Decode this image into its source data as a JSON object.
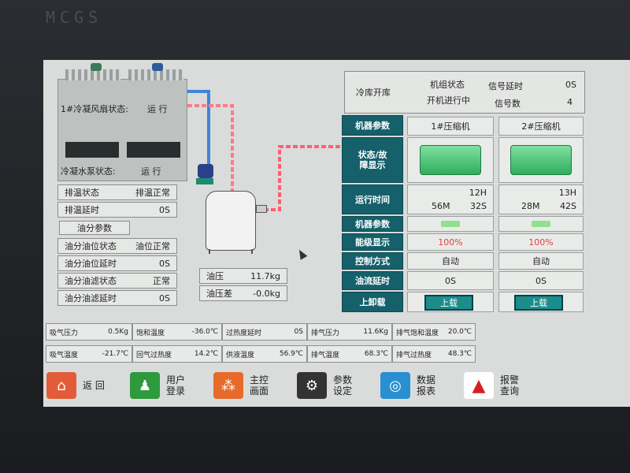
{
  "brand": "MCGS",
  "top_panel": {
    "mode": "冷库开库",
    "unit_status_label": "机组状态",
    "unit_status_value": "开机进行中",
    "signal_delay_label": "信号延时",
    "signal_delay_value": "0S",
    "signal_count_label": "信号数",
    "signal_count_value": "4"
  },
  "condenser": {
    "fan_status_label": "1#冷凝风扇状态:",
    "fan_status_value": "运 行",
    "pump_status_label": "冷凝水泵状态:",
    "pump_status_value": "运 行"
  },
  "discharge": [
    {
      "label": "排温状态",
      "value": "排温正常"
    },
    {
      "label": "排温延时",
      "value": "0S"
    }
  ],
  "oil_params_title": "油分参数",
  "oil": [
    {
      "label": "油分油位状态",
      "value": "油位正常"
    },
    {
      "label": "油分油位延时",
      "value": "0S"
    },
    {
      "label": "油分油滤状态",
      "value": "正常"
    },
    {
      "label": "油分油滤延时",
      "value": "0S"
    }
  ],
  "oil_pressure": [
    {
      "label": "油压",
      "value": "11.7kg"
    },
    {
      "label": "油压差",
      "value": "-0.0kg"
    }
  ],
  "compressor_table": {
    "row_labels": [
      "机器参数",
      "状态/故障显示",
      "运行时间",
      "机器参数",
      "能级显示",
      "控制方式",
      "油流延时",
      "上卸载"
    ],
    "headers": [
      "1#压缩机",
      "2#压缩机"
    ],
    "run_time": [
      {
        "h": "12H",
        "m": "56M",
        "s": "32S"
      },
      {
        "h": "13H",
        "m": "28M",
        "s": "42S"
      }
    ],
    "capacity": [
      "100%",
      "100%"
    ],
    "control_mode": [
      "自动",
      "自动"
    ],
    "oil_flow_delay": [
      "0S",
      "0S"
    ],
    "load_buttons": [
      "上载",
      "上载"
    ]
  },
  "status_bar_row1": [
    {
      "label": "吸气压力",
      "value": "0.5Kg"
    },
    {
      "label": "饱和温度",
      "value": "-36.0℃"
    },
    {
      "label": "过热度延时",
      "value": "0S"
    },
    {
      "label": "排气压力",
      "value": "11.6Kg"
    },
    {
      "label": "排气饱和温度",
      "value": "20.0℃"
    }
  ],
  "status_bar_row2": [
    {
      "label": "吸气温度",
      "value": "-21.7℃"
    },
    {
      "label": "回气过热度",
      "value": "14.2℃"
    },
    {
      "label": "供液温度",
      "value": "56.9℃"
    },
    {
      "label": "排气温度",
      "value": "68.3℃"
    },
    {
      "label": "排气过热度",
      "value": "48.3℃"
    }
  ],
  "nav": [
    {
      "label": "返 回",
      "icon": "home-icon",
      "color": "#e25c3a"
    },
    {
      "label": "用户\n登录",
      "icon": "user-book-icon",
      "color": "#2e9a3c"
    },
    {
      "label": "主控\n画面",
      "icon": "network-icon",
      "color": "#e86a2a"
    },
    {
      "label": "参数\n设定",
      "icon": "gear-icon",
      "color": "#333333"
    },
    {
      "label": "数据\n报表",
      "icon": "globe-icon",
      "color": "#2a8fd0"
    },
    {
      "label": "报警\n查询",
      "icon": "warning-icon",
      "color": "#d42020"
    }
  ]
}
